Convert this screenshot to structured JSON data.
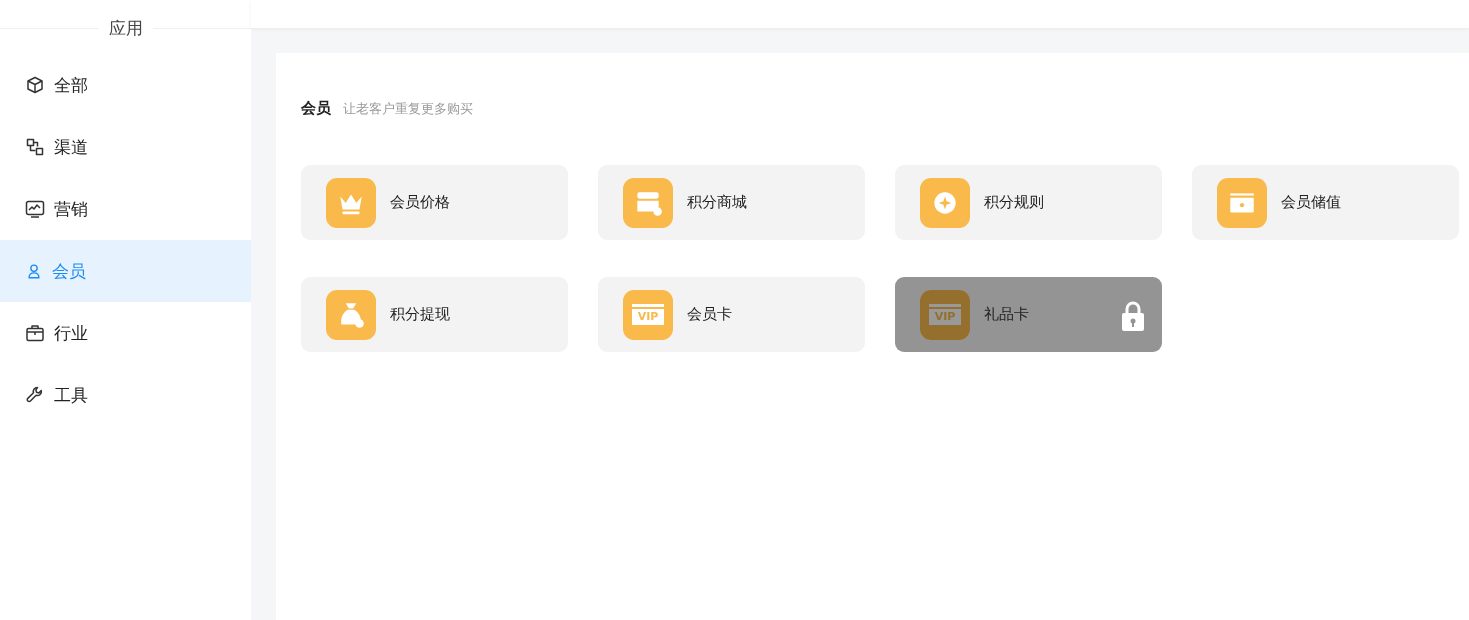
{
  "sidebar": {
    "heading": "应用",
    "items": [
      {
        "label": "全部",
        "kind": "cube",
        "selected": false
      },
      {
        "label": "渠道",
        "kind": "channels",
        "selected": false
      },
      {
        "label": "营销",
        "kind": "monitor",
        "selected": false
      },
      {
        "label": "会员",
        "kind": "user",
        "selected": true
      },
      {
        "label": "行业",
        "kind": "briefcase",
        "selected": false
      },
      {
        "label": "工具",
        "kind": "wrench",
        "selected": false
      }
    ]
  },
  "section": {
    "title": "会员",
    "subtitle": "让老客户重复更多购买",
    "apps": [
      {
        "label": "会员价格",
        "kind": "crown",
        "locked": false
      },
      {
        "label": "积分商城",
        "kind": "shop",
        "locked": false
      },
      {
        "label": "积分规则",
        "kind": "rule",
        "locked": false
      },
      {
        "label": "会员储值",
        "kind": "wallet",
        "locked": false
      },
      {
        "label": "积分提现",
        "kind": "bag",
        "locked": false
      },
      {
        "label": "会员卡",
        "kind": "vip",
        "icon_text": "VIP",
        "locked": false
      },
      {
        "label": "礼品卡",
        "kind": "vip",
        "icon_text": "VIP",
        "locked": true
      }
    ]
  }
}
